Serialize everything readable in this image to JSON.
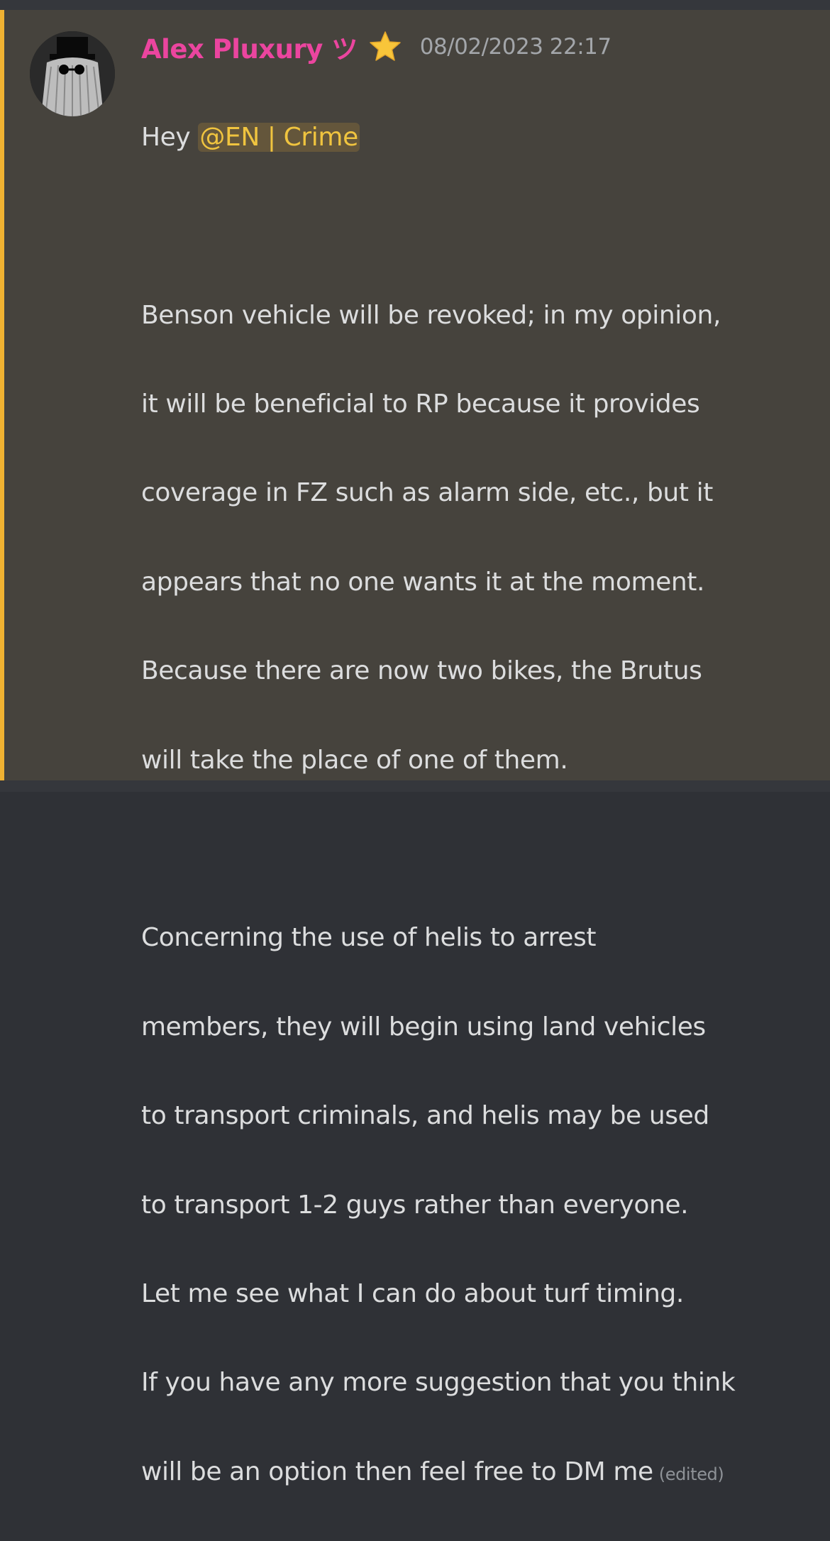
{
  "message": {
    "author": "Alex Pluxury ツ",
    "author_color": "#eb459f",
    "badge_icon": "star-icon",
    "timestamp": "08/02/2023 22:17",
    "greeting": "Hey ",
    "mention": "@EN | Crime",
    "mention_color": "#f0c43f",
    "accent_color": "#f0b232",
    "lines": [
      "Benson vehicle will be revoked; in my opinion,",
      "it will be beneficial to RP because it provides",
      "coverage in FZ such as alarm side, etc., but it",
      "appears that no one wants it at the moment.",
      "Because there are now two bikes, the Brutus",
      "will take the place of one of them.",
      "",
      "Concerning the use of helis to arrest",
      "members, they will begin using land vehicles",
      "to transport criminals, and helis may be used",
      "to transport 1-2 guys rather than everyone.",
      "Let me see what I can do about turf timing.",
      "If you have any more suggestion that you think"
    ],
    "last_line": "will be an option then feel free to DM me",
    "edited_label": "(edited)"
  }
}
